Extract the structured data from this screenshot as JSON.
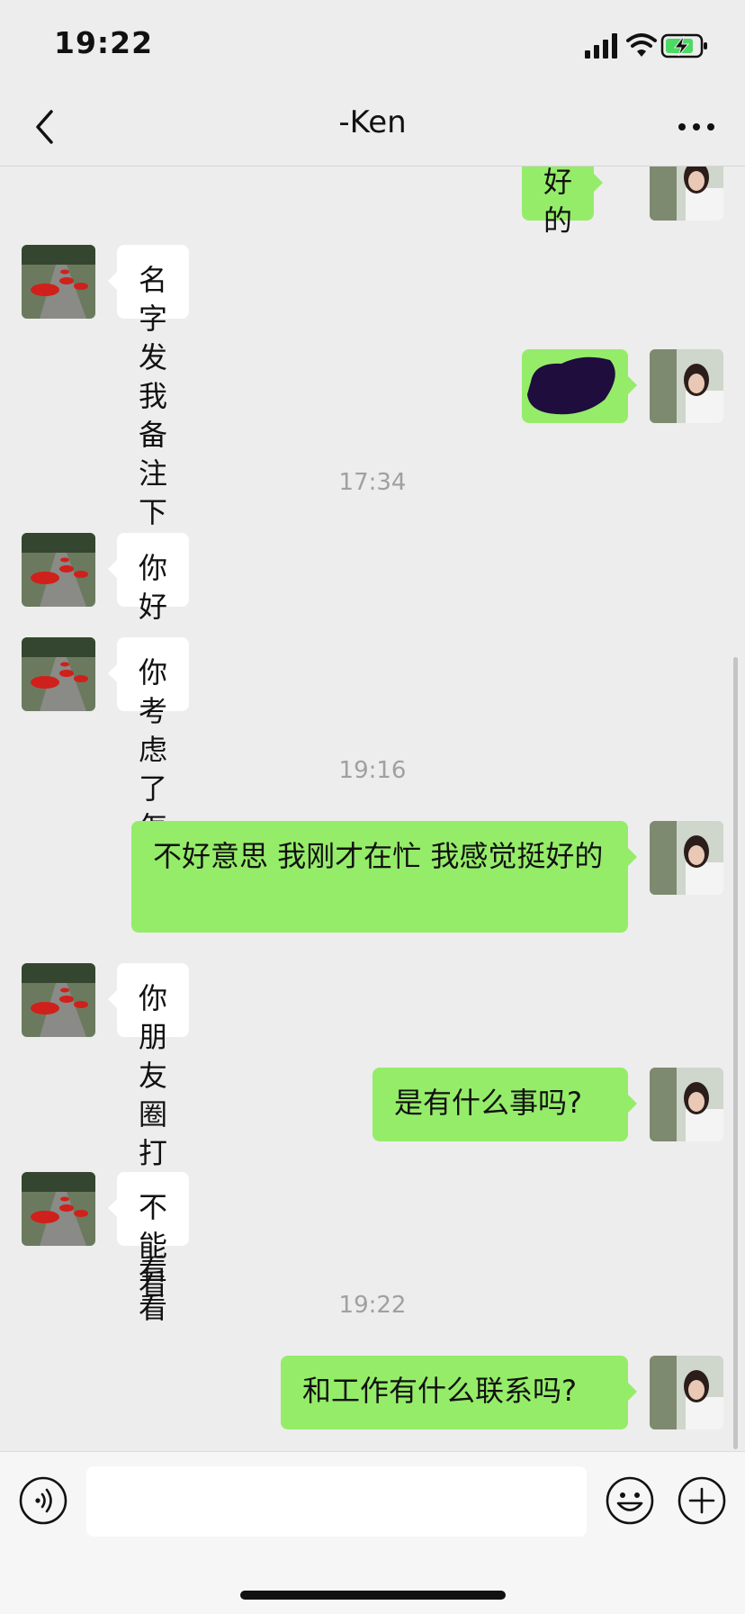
{
  "status_bar": {
    "time": "19:22",
    "icons": [
      "cellular-signal-icon",
      "wifi-icon",
      "battery-charging-icon"
    ]
  },
  "header": {
    "title": "-Ken",
    "back_icon": "chevron-left-icon",
    "more_icon": "more-dots-icon"
  },
  "messages": [
    {
      "side": "out",
      "text": "好的"
    },
    {
      "side": "in",
      "text": "名字发我备注下"
    },
    {
      "side": "out",
      "text": "",
      "note": "redacted"
    },
    {
      "time": "17:34"
    },
    {
      "side": "in",
      "text": "你好"
    },
    {
      "side": "in",
      "text": "你考虑了怎么样"
    },
    {
      "time": "19:16"
    },
    {
      "side": "out",
      "text": "不好意思 我刚才在忙 我感觉挺好的"
    },
    {
      "side": "in",
      "text": "你朋友圈打开我看看"
    },
    {
      "side": "out",
      "text": "是有什么事吗?"
    },
    {
      "side": "in",
      "text": "不能看"
    },
    {
      "time": "19:22"
    },
    {
      "side": "out",
      "text": "和工作有什么联系吗?"
    }
  ],
  "input_bar": {
    "placeholder": "",
    "voice_icon": "voice-icon",
    "emoji_icon": "emoji-icon",
    "plus_icon": "plus-icon"
  },
  "colors": {
    "background": "#ededed",
    "incoming_bubble": "#ffffff",
    "outgoing_bubble": "#95ec69",
    "timestamp": "#a0a0a0"
  }
}
